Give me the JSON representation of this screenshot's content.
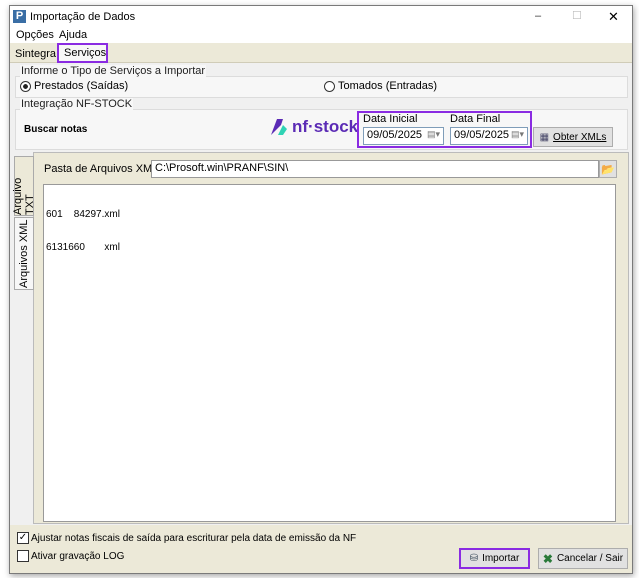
{
  "window": {
    "title": "Importação de Dados",
    "controls": {
      "minimize": "–",
      "maximize": "☐",
      "close": "✕"
    }
  },
  "menu": [
    "Opções",
    "Ajuda"
  ],
  "tabs": [
    {
      "label": "Sintegra",
      "selected": false
    },
    {
      "label": "Serviços",
      "selected": true
    }
  ],
  "service_type": {
    "legend": "Informe o Tipo de Serviços a Importar",
    "options": [
      {
        "label": "Prestados (Saídas)",
        "checked": true
      },
      {
        "label": "Tomados (Entradas)",
        "checked": false
      }
    ]
  },
  "nfstock": {
    "legend": "Integração NF-STOCK",
    "buscar_label": "Buscar notas",
    "logo_text": "nf·stock",
    "data_inicial_label": "Data Inicial",
    "data_inicial": "09/05/2025",
    "data_final_label": "Data Final",
    "data_final": "09/05/2025",
    "obter_label": "Obter XMLs"
  },
  "side_tabs": [
    {
      "label": "Arquivo TXT",
      "selected": false
    },
    {
      "label": "Arquivos XML",
      "selected": true
    }
  ],
  "xml": {
    "folder_label": "Pasta de Arquivos XML:",
    "folder_value": "C:\\Prosoft.win\\PRANF\\SIN\\",
    "files": [
      "601    84297.xml",
      "6131660       xml"
    ]
  },
  "options": {
    "ajustar_label": "Ajustar notas fiscais de saída para escriturar pela data de emissão da NF",
    "ajustar_checked": true,
    "log_label": "Ativar gravação LOG",
    "log_checked": false
  },
  "buttons": {
    "importar": "Importar",
    "cancelar": "Cancelar / Sair"
  },
  "colors": {
    "highlight": "#8a2be2",
    "tab_bg": "#ece9d8",
    "logo_purple": "#5b2bb5",
    "logo_teal": "#2fd3b5"
  }
}
